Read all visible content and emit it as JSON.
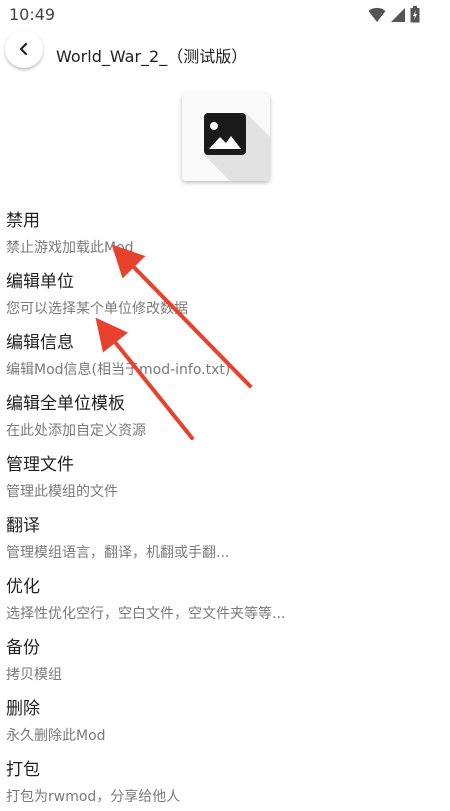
{
  "status_bar": {
    "time": "10:49",
    "icons": [
      "wifi-icon",
      "signal-icon",
      "battery-icon"
    ]
  },
  "header": {
    "title": "World_War_2_（测试版）",
    "back_icon": "back-arrow-icon"
  },
  "mod_icon": "image-placeholder-icon",
  "menu": {
    "items": [
      {
        "label": "禁用",
        "desc": "禁止游戏加载此Mod"
      },
      {
        "label": "编辑单位",
        "desc": "您可以选择某个单位修改数据"
      },
      {
        "label": "编辑信息",
        "desc": "编辑Mod信息(相当于mod-info.txt)"
      },
      {
        "label": "编辑全单位模板",
        "desc": "在此处添加自定义资源"
      },
      {
        "label": "管理文件",
        "desc": "管理此模组的文件"
      },
      {
        "label": "翻译",
        "desc": "管理模组语言，翻译，机翻或手翻..."
      },
      {
        "label": "优化",
        "desc": "选择性优化空行，空白文件，空文件夹等等..."
      },
      {
        "label": "备份",
        "desc": "拷贝模组"
      },
      {
        "label": "删除",
        "desc": "永久删除此Mod"
      },
      {
        "label": "打包",
        "desc": "打包为rwmod，分享给他人"
      }
    ]
  },
  "colors": {
    "annotation_arrow": "#e8412c",
    "secondary_text": "#7a7a7a"
  }
}
